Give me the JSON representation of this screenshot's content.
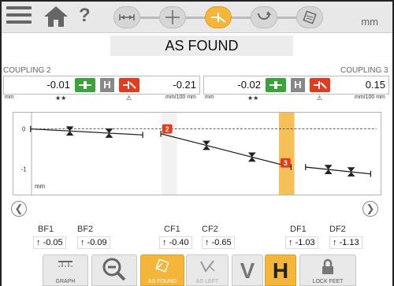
{
  "header": {
    "unit": "mm",
    "help": "?"
  },
  "title": "AS FOUND",
  "coupling2": {
    "label": "COUPLING 2",
    "offset": "-0.01",
    "angle": "-0.21",
    "h": "H",
    "unit_left": "mm",
    "stars": "★★",
    "warn": "⚠",
    "unit_right": "mm/100 mm"
  },
  "coupling3": {
    "label": "COUPLING 3",
    "offset": "-0.02",
    "angle": "0.15",
    "h": "H",
    "unit_left": "mm",
    "stars": "★★",
    "warn": "⚠",
    "unit_right": "mm/100 mm"
  },
  "chart_data": {
    "type": "line",
    "yticks": [
      "0",
      "-1"
    ],
    "unit": "mm",
    "markers": [
      "2",
      "3"
    ],
    "segments": [
      {
        "x": [
          0.04,
          0.35
        ],
        "y": [
          0.0,
          -0.15
        ]
      },
      {
        "x": [
          0.4,
          0.76
        ],
        "y": [
          -0.12,
          -0.95
        ]
      },
      {
        "x": [
          0.8,
          0.98
        ],
        "y": [
          -0.95,
          -1.12
        ]
      }
    ]
  },
  "measurements": {
    "bf1": {
      "label": "BF1",
      "value": "-0.05"
    },
    "bf2": {
      "label": "BF2",
      "value": "-0.09"
    },
    "cf1": {
      "label": "CF1",
      "value": "-0.40"
    },
    "cf2": {
      "label": "CF2",
      "value": "-0.65"
    },
    "df1": {
      "label": "DF1",
      "value": "-1.03"
    },
    "df2": {
      "label": "DF2",
      "value": "-1.13"
    },
    "arrow": "↑"
  },
  "toolbar": {
    "graph": "GRAPH",
    "as_found": "AS FOUND",
    "as_left": "AS LEFT",
    "v": "V",
    "h": "H",
    "lock_feet": "LOCK FEET"
  },
  "colors": {
    "accent": "#f3b63a",
    "green": "#3aa33a",
    "red": "#e23b1e"
  }
}
